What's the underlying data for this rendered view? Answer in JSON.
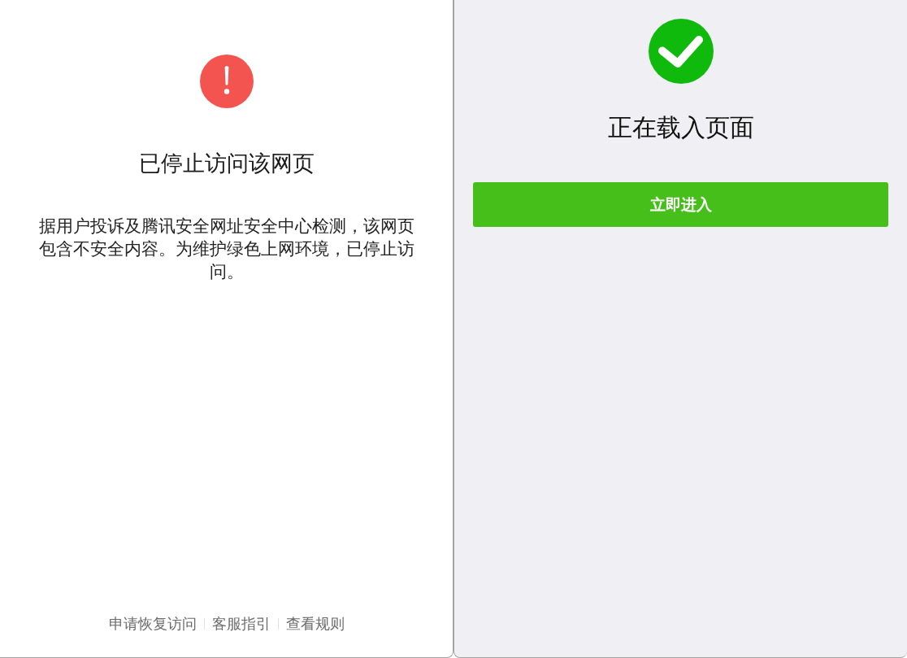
{
  "blocked_panel": {
    "title": "已停止访问该网页",
    "message": "据用户投诉及腾讯安全网址安全中心检测，该网页包含不安全内容。为维护绿色上网环境，已停止访问。",
    "footer_links": [
      "申请恢复访问",
      "客服指引",
      "查看规则"
    ]
  },
  "loading_panel": {
    "title": "正在载入页面",
    "enter_button": "立即进入"
  }
}
